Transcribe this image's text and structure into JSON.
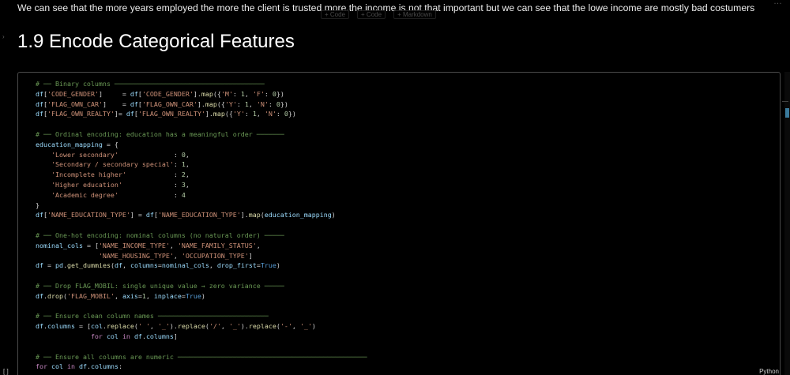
{
  "markdown_cell": {
    "text": "We can see that the more years employed the more the client is trusted more.the income is not that important but we can see that the lowe income are mostly bad costumers"
  },
  "cell_toolbar": {
    "items": [
      "+ Code",
      "+ Code",
      "+ Markdown"
    ]
  },
  "heading": "1.9 Encode Categorical Features",
  "code_cell": {
    "language_label": "Python",
    "execution_label": "[ ]",
    "lines": [
      "# ── Binary columns ──────────────────────────────────────",
      "df['CODE_GENDER']     = df['CODE_GENDER'].map({'M': 1, 'F': 0})",
      "df['FLAG_OWN_CAR']    = df['FLAG_OWN_CAR'].map({'Y': 1, 'N': 0})",
      "df['FLAG_OWN_REALTY']= df['FLAG_OWN_REALTY'].map({'Y': 1, 'N': 0})",
      "",
      "# ── Ordinal encoding: education has a meaningful order ───────",
      "education_mapping = {",
      "    'Lower secondary'              : 0,",
      "    'Secondary / secondary special': 1,",
      "    'Incomplete higher'            : 2,",
      "    'Higher education'             : 3,",
      "    'Academic degree'              : 4",
      "}",
      "df['NAME_EDUCATION_TYPE'] = df['NAME_EDUCATION_TYPE'].map(education_mapping)",
      "",
      "# ── One-hot encoding: nominal columns (no natural order) ─────",
      "nominal_cols = ['NAME_INCOME_TYPE', 'NAME_FAMILY_STATUS',",
      "                'NAME_HOUSING_TYPE', 'OCCUPATION_TYPE']",
      "df = pd.get_dummies(df, columns=nominal_cols, drop_first=True)",
      "",
      "# ── Drop FLAG_MOBIL: single unique value → zero variance ─────",
      "df.drop('FLAG_MOBIL', axis=1, inplace=True)",
      "",
      "# ── Ensure clean column names ────────────────────────────",
      "df.columns = [col.replace(' ', '_').replace('/', '_').replace('-', '_')",
      "              for col in df.columns]",
      "",
      "# ── Ensure all columns are numeric ────────────────────────────────────────────────",
      "for col in df.columns:"
    ]
  },
  "colors": {
    "background": "#000000",
    "comment": "#6a9955",
    "string": "#ce9178",
    "number": "#b5cea8",
    "variable": "#9cdcfe",
    "scrollbar_thumb": "#3a7a9c"
  },
  "icons": {
    "collapse": "chevron-right-icon",
    "more": "ellipsis-icon"
  }
}
